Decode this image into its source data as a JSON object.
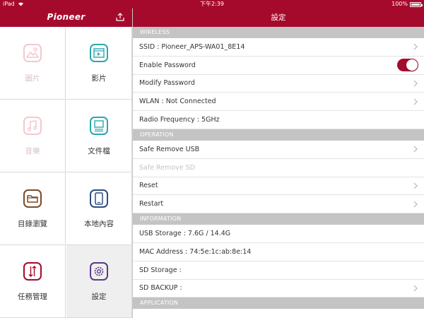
{
  "status_bar": {
    "device": "iPad",
    "wifi_icon": "wifi-icon",
    "time": "下午2:39",
    "battery_text": "100%"
  },
  "sidebar": {
    "logo": "Pioneer",
    "upload_icon": "upload-icon",
    "tiles": [
      {
        "label": "圖片",
        "icon": "photo-icon",
        "disabled": true
      },
      {
        "label": "影片",
        "icon": "video-icon",
        "disabled": false
      },
      {
        "label": "音樂",
        "icon": "music-icon",
        "disabled": true
      },
      {
        "label": "文件檔",
        "icon": "document-icon",
        "disabled": false
      },
      {
        "label": "目錄瀏覽",
        "icon": "folder-icon",
        "disabled": false
      },
      {
        "label": "本地內容",
        "icon": "phone-icon",
        "disabled": false
      },
      {
        "label": "任務管理",
        "icon": "transfer-icon",
        "disabled": false
      },
      {
        "label": "設定",
        "icon": "gear-icon",
        "disabled": false,
        "active": true
      }
    ]
  },
  "main": {
    "title": "設定",
    "sections": [
      {
        "header": "WIRELESS",
        "rows": [
          {
            "label": "SSID : Pioneer_APS-WA01_8E14",
            "chevron": true
          },
          {
            "label": "Enable Password",
            "toggle": true,
            "toggle_on": true
          },
          {
            "label": "Modify Password",
            "chevron": true
          },
          {
            "label": "WLAN : Not Connected",
            "chevron": true
          },
          {
            "label": "Radio Frequency : 5GHz",
            "chevron": false
          }
        ]
      },
      {
        "header": "OPERATION",
        "rows": [
          {
            "label": "Safe Remove USB",
            "chevron": true
          },
          {
            "label": "Safe Remove SD",
            "chevron": false,
            "disabled": true
          },
          {
            "label": "Reset",
            "chevron": true
          },
          {
            "label": "Restart",
            "chevron": true
          }
        ]
      },
      {
        "header": "INFORMATION",
        "rows": [
          {
            "label": "USB Storage : 7.6G / 14.4G",
            "chevron": false
          },
          {
            "label": "MAC Address : 74:5e:1c:ab:8e:14",
            "chevron": false
          },
          {
            "label": "SD Storage :",
            "chevron": false
          },
          {
            "label": "SD BACKUP :",
            "chevron": true
          }
        ]
      },
      {
        "header": "APPLICATION",
        "rows": []
      }
    ]
  },
  "colors": {
    "brand": "#a50a2c",
    "section_header": "#c4c4c4",
    "icon_teal": "#2aa7b0",
    "icon_brown": "#7a4a2a",
    "icon_navy": "#2b4d7e",
    "icon_purple": "#5a3a8a",
    "icon_disabled": "#f3c9cf"
  }
}
